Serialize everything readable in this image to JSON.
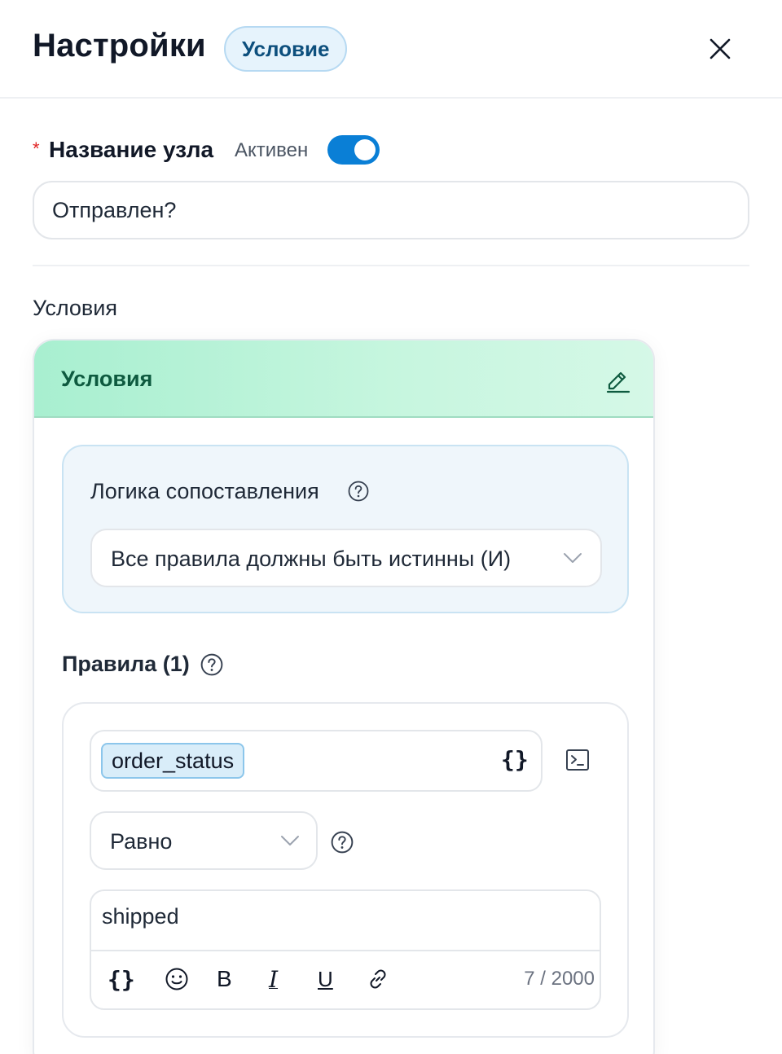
{
  "header": {
    "title": "Настройки",
    "type_badge": "Условие"
  },
  "node_name": {
    "label": "Название узла",
    "required_mark": "*",
    "active_label": "Активен",
    "active": true,
    "value": "Отправлен?"
  },
  "conditions_section": {
    "label": "Условия",
    "card_title": "Условия",
    "logic": {
      "label": "Логика сопоставления",
      "selected": "Все правила должны быть истинны (И)"
    },
    "rules": {
      "label": "Правила (1)",
      "items": [
        {
          "variable": "order_status",
          "variable_button": "{}",
          "operator": "Равно",
          "value": "shipped",
          "char_count": "7 / 2000"
        }
      ]
    }
  },
  "toolbar": {
    "variables": "{}",
    "bold": "B",
    "italic": "I",
    "underline": "U"
  },
  "colors": {
    "accent": "#0a7fd6",
    "badge_bg": "#e6f3fc",
    "card_header": "#a8efd0",
    "logic_bg": "#eff6fb",
    "chip_bg": "#d9edf9"
  }
}
